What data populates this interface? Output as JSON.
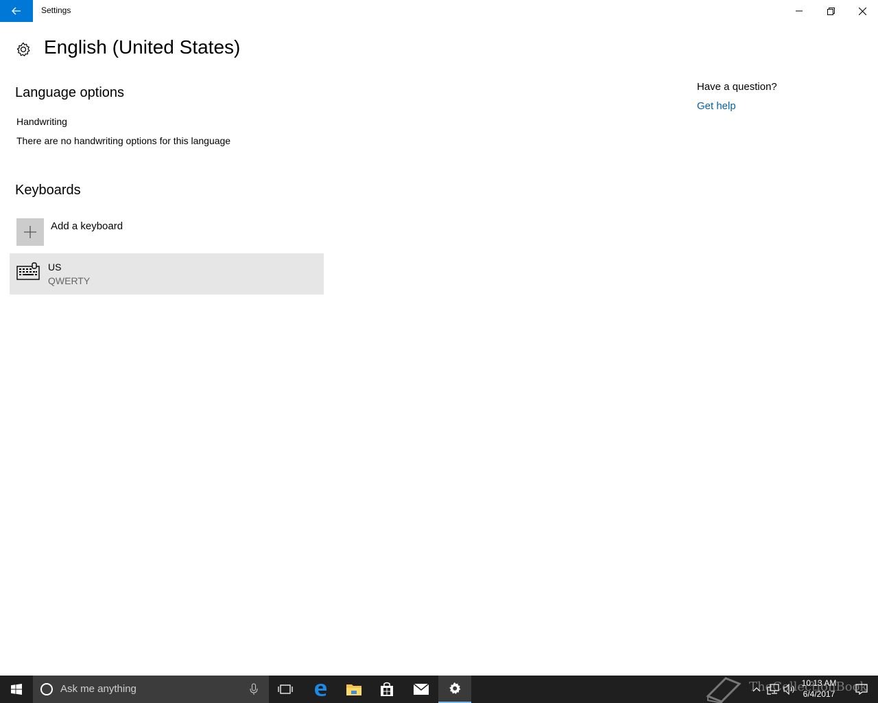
{
  "window": {
    "title": "Settings"
  },
  "page": {
    "title": "English (United States)"
  },
  "language_options": {
    "heading": "Language options",
    "handwriting_label": "Handwriting",
    "handwriting_desc": "There are no handwriting options for this language"
  },
  "keyboards": {
    "heading": "Keyboards",
    "add_label": "Add a keyboard",
    "items": [
      {
        "name": "US",
        "layout": "QWERTY"
      }
    ]
  },
  "help": {
    "question": "Have a question?",
    "link": "Get help"
  },
  "taskbar": {
    "search_placeholder": "Ask me anything",
    "time": "10:13 AM",
    "date": "6/4/2017",
    "watermark": "TheCollectionBook"
  },
  "colors": {
    "accent": "#0078d7",
    "link": "#0063b1",
    "taskbar": "#1f1f1f"
  },
  "icons": [
    "back-arrow-icon",
    "minimize-icon",
    "maximize-icon",
    "close-icon",
    "gear-icon",
    "plus-icon",
    "keyboard-icon",
    "windows-logo-icon",
    "cortana-icon",
    "microphone-icon",
    "task-view-icon",
    "edge-icon",
    "file-explorer-icon",
    "store-icon",
    "mail-icon",
    "settings-icon",
    "chevron-up-icon",
    "network-icon",
    "volume-icon",
    "notification-icon"
  ]
}
